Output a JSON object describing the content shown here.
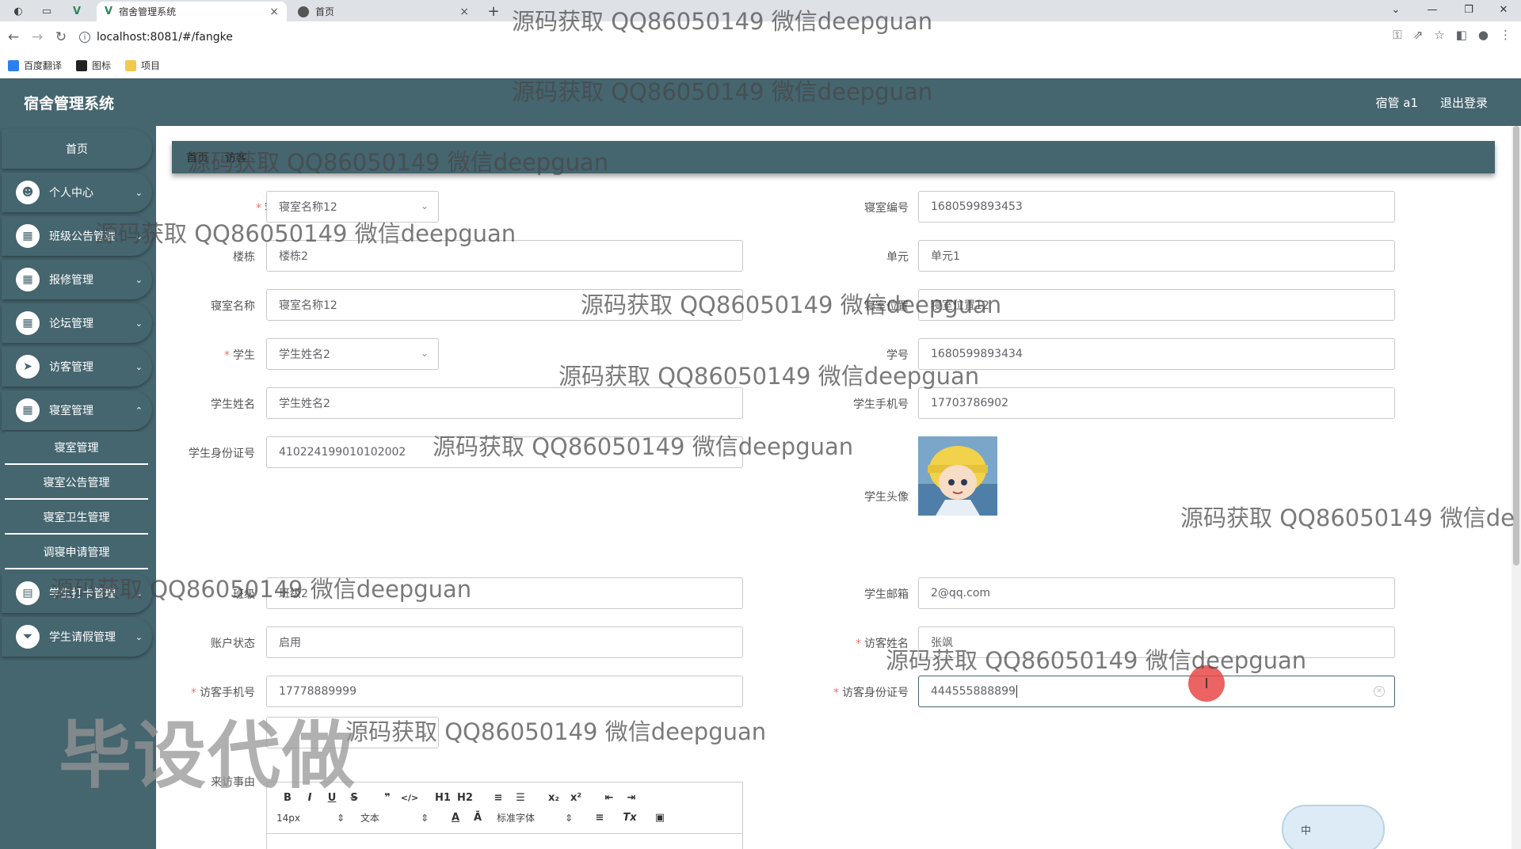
{
  "browser": {
    "tabs": [
      {
        "title": "宿舍管理系统",
        "close": "×"
      },
      {
        "title": "首页",
        "close": "×"
      }
    ],
    "new_tab": "+",
    "url": "localhost:8081/#/fangke",
    "bookmarks": [
      "百度翻译",
      "图标",
      "项目"
    ],
    "window_controls": [
      "⌄",
      "—",
      "❐",
      "✕"
    ]
  },
  "header": {
    "title": "宿舍管理系统",
    "user": "宿管 a1",
    "logout": "退出登录"
  },
  "sidebar": {
    "home": "首页",
    "items": [
      {
        "label": "个人中心",
        "icon": "user-icon"
      },
      {
        "label": "班级公告管理",
        "icon": "grid-icon"
      },
      {
        "label": "报修管理",
        "icon": "grid-icon"
      },
      {
        "label": "论坛管理",
        "icon": "grid-icon"
      },
      {
        "label": "访客管理",
        "icon": "send-icon"
      },
      {
        "label": "寝室管理",
        "icon": "grid-icon"
      }
    ],
    "submenu": [
      "寝室管理",
      "寝室公告管理",
      "寝室卫生管理",
      "调寝申请管理"
    ],
    "items_after": [
      {
        "label": "学生打卡管理",
        "icon": "calendar-icon"
      },
      {
        "label": "学生请假管理",
        "icon": "filter-icon"
      }
    ]
  },
  "breadcrumb": {
    "home": "首页",
    "separator": "/",
    "current": "访客"
  },
  "form": {
    "dorm_label": "寝室",
    "dorm_value": "寝室名称12",
    "dorm_no_label": "寝室编号",
    "dorm_no_value": "1680599893453",
    "building_label": "楼栋",
    "building_value": "楼栋2",
    "unit_label": "单元",
    "unit_value": "单元1",
    "dorm_name_label": "寝室名称",
    "dorm_name_value": "寝室名称12",
    "dorm_addr_label": "寝室位置",
    "dorm_addr_value": "寝室位置12",
    "student_label": "学生",
    "student_value": "学生姓名2",
    "student_no_label": "学号",
    "student_no_value": "1680599893434",
    "student_name_label": "学生姓名",
    "student_name_value": "学生姓名2",
    "student_phone_label": "学生手机号",
    "student_phone_value": "17703786902",
    "student_id_label": "学生身份证号",
    "student_id_value": "410224199010102002",
    "avatar_label": "学生头像",
    "class_label": "班级",
    "class_value": "班级2",
    "email_label": "学生邮箱",
    "email_value": "2@qq.com",
    "status_label": "账户状态",
    "status_value": "启用",
    "visitor_name_label": "访客姓名",
    "visitor_name_value": "张飒",
    "visitor_phone_label": "访客手机号",
    "visitor_phone_value": "17778889999",
    "visitor_id_label": "访客身份证号",
    "visitor_id_value": "444555888899",
    "reason_label": "来访事由"
  },
  "editor": {
    "row1": [
      "B",
      "I",
      "U",
      "S",
      "❞",
      "</>",
      "H1",
      "H2",
      "≡",
      "☰",
      "x₂",
      "x²",
      "⇤",
      "⇥"
    ],
    "size": "14px",
    "format": "文本",
    "font": "标准字体",
    "row2": [
      "A",
      "Ā",
      "≡",
      "Tx",
      "▣"
    ]
  },
  "watermarks": {
    "text": "源码获取 QQ86050149 微信deepguan",
    "text_cut": "源码获取 QQ86050149 微信de",
    "big": "毕设代做"
  },
  "ime": "中",
  "colors": {
    "primary": "#45656f",
    "required": "#f56c6c"
  }
}
